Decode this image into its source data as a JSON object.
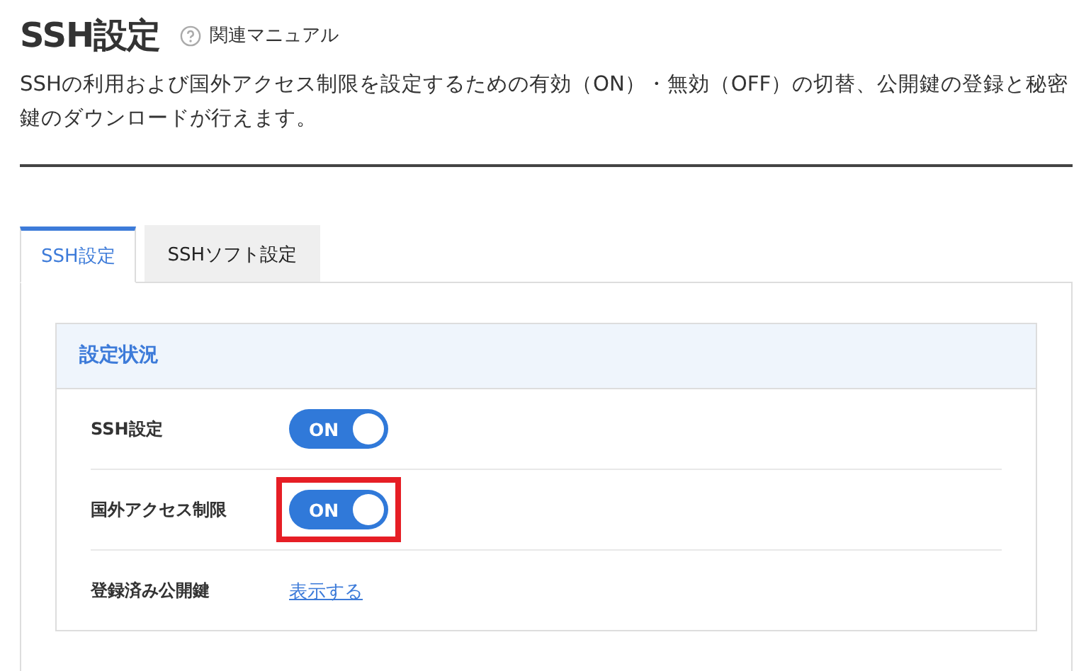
{
  "page": {
    "title": "SSH設定",
    "manual_link": "関連マニュアル",
    "description": "SSHの利用および国外アクセス制限を設定するための有効（ON）・無効（OFF）の切替、公開鍵の登録と秘密鍵のダウンロードが行えます。"
  },
  "tabs": [
    {
      "label": "SSH設定",
      "selected": true
    },
    {
      "label": "SSHソフト設定",
      "selected": false
    }
  ],
  "panel": {
    "title": "設定状況",
    "rows": [
      {
        "label": "SSH設定",
        "kind": "toggle",
        "on": true,
        "value": "ON",
        "highlighted": false
      },
      {
        "label": "国外アクセス制限",
        "kind": "toggle",
        "on": true,
        "value": "ON",
        "highlighted": true
      },
      {
        "label": "登録済み公開鍵",
        "kind": "link",
        "value": "表示する"
      }
    ]
  }
}
